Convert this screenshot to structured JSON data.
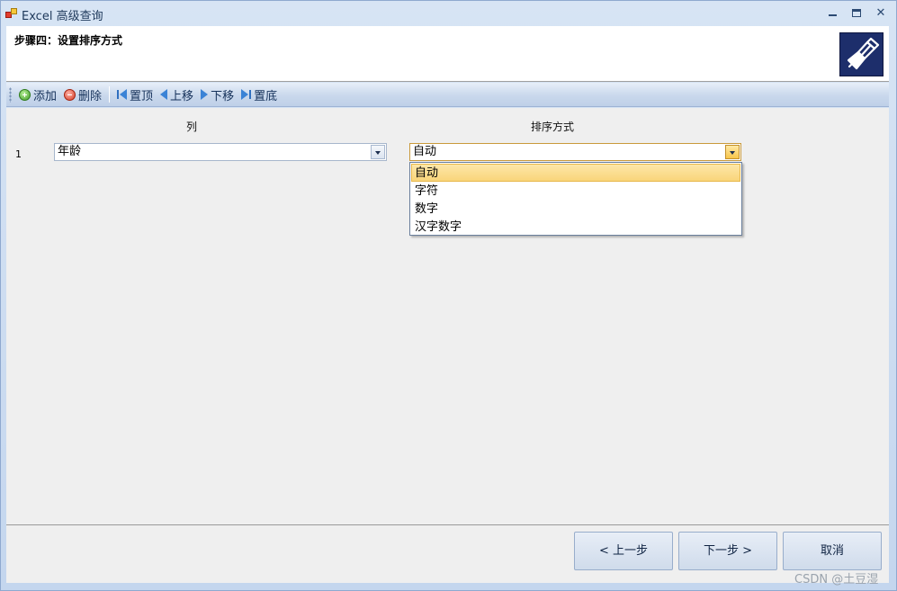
{
  "window": {
    "title": "Excel 高级查询",
    "min_icon": "minimize-icon",
    "max_icon": "maximize-icon",
    "close_glyph": "✕"
  },
  "header": {
    "step_title": "步骤四：设置排序方式",
    "logo_icon": "wizard-logo-icon"
  },
  "toolbar": {
    "add": "添加",
    "delete": "删除",
    "top": "置顶",
    "up": "上移",
    "down": "下移",
    "bottom": "置底"
  },
  "grid": {
    "columns": [
      "列",
      "排序方式"
    ],
    "rows": [
      {
        "num": "1",
        "column": "年龄",
        "sort": "自动"
      }
    ]
  },
  "dropdown": {
    "options": [
      "自动",
      "字符",
      "数字",
      "汉字数字"
    ],
    "selected_index": 0
  },
  "footer": {
    "prev": "< 上一步",
    "next": "下一步 >",
    "cancel": "取消"
  },
  "watermark": "CSDN @土豆湿",
  "colors": {
    "selection": "#f9d57a",
    "toolbar_text": "#15315a"
  }
}
